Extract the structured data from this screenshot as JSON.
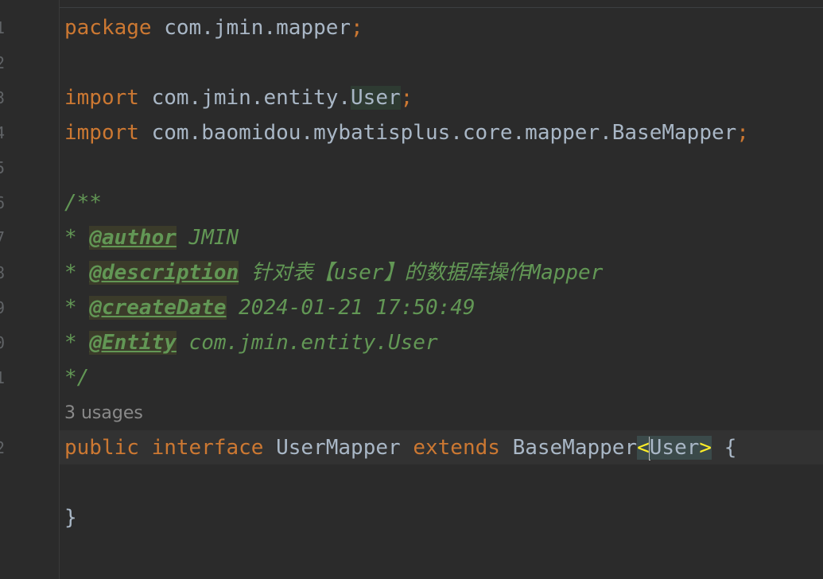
{
  "editor": {
    "gutter_numbers": [
      "1",
      "2",
      "3",
      "4",
      "5",
      "6",
      "7",
      "8",
      "9",
      "0",
      "1",
      "",
      "2",
      "",
      ""
    ],
    "lines": {
      "l1": {
        "kw": "package",
        "pkg": " com.jmin.mapper",
        "semi": ";"
      },
      "l3": {
        "kw": "import",
        "path": " com.jmin.entity.",
        "cls": "User",
        "semi": ";"
      },
      "l4": {
        "kw": "import",
        "path": " com.baomidou.mybatisplus.core.mapper.BaseMapper",
        "semi": ";"
      },
      "l6": {
        "text": "/**"
      },
      "l7": {
        "star": "* ",
        "tag": "@author",
        "rest": " JMIN"
      },
      "l8": {
        "star": "* ",
        "tag": "@description",
        "rest": " 针对表【user】的数据库操作Mapper"
      },
      "l9": {
        "star": "* ",
        "tag": "@createDate",
        "rest": " 2024-01-21 17:50:49"
      },
      "l10": {
        "star": "* ",
        "tag": "@Entity",
        "rest": " com.jmin.entity.User"
      },
      "l11": {
        "text": "*/"
      },
      "usages": "3 usages",
      "l12": {
        "kw1": "public",
        "kw2": "interface",
        "name": "UserMapper",
        "kw3": "extends",
        "base": "BaseMapper",
        "lt": "<",
        "type": "User",
        "gt": ">",
        "brace": " {"
      },
      "l14": {
        "text": "}"
      }
    },
    "colors": {
      "background": "#2b2b2b",
      "keyword": "#cc7832",
      "plain": "#a9b7c6",
      "doc_comment": "#629755",
      "brace_highlight": "#ffef28",
      "current_line": "#323232"
    }
  }
}
